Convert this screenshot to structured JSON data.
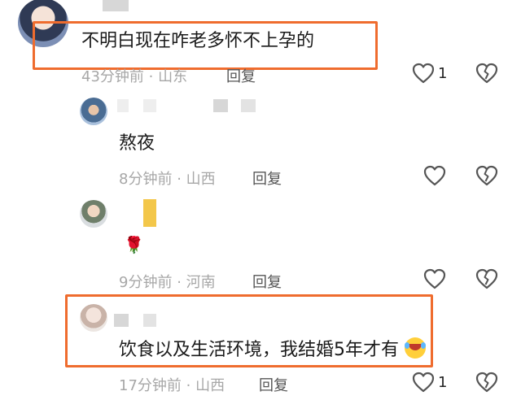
{
  "comments": [
    {
      "text": "不明白现在咋老多怀不上孕的",
      "time": "43分钟前",
      "sep": "·",
      "location": "山东",
      "reply_label": "回复",
      "like_count": "1"
    },
    {
      "text": "熬夜",
      "time": "8分钟前",
      "sep": "·",
      "location": "山西",
      "reply_label": "回复",
      "like_count": ""
    },
    {
      "text": "🌹",
      "time": "9分钟前",
      "sep": "·",
      "location": "河南",
      "reply_label": "回复",
      "like_count": ""
    },
    {
      "text": "饮食以及生活环境，我结婚5年才有",
      "time": "17分钟前",
      "sep": "·",
      "location": "山西",
      "reply_label": "回复",
      "like_count": "1"
    }
  ],
  "colors": {
    "highlight": "#ef6c2e",
    "meta_gray": "#a7a7a7",
    "icon_gray": "#555555"
  },
  "icons": [
    "heart-icon",
    "broken-heart-icon",
    "rose-emoji",
    "crying-laughing-emoji"
  ]
}
